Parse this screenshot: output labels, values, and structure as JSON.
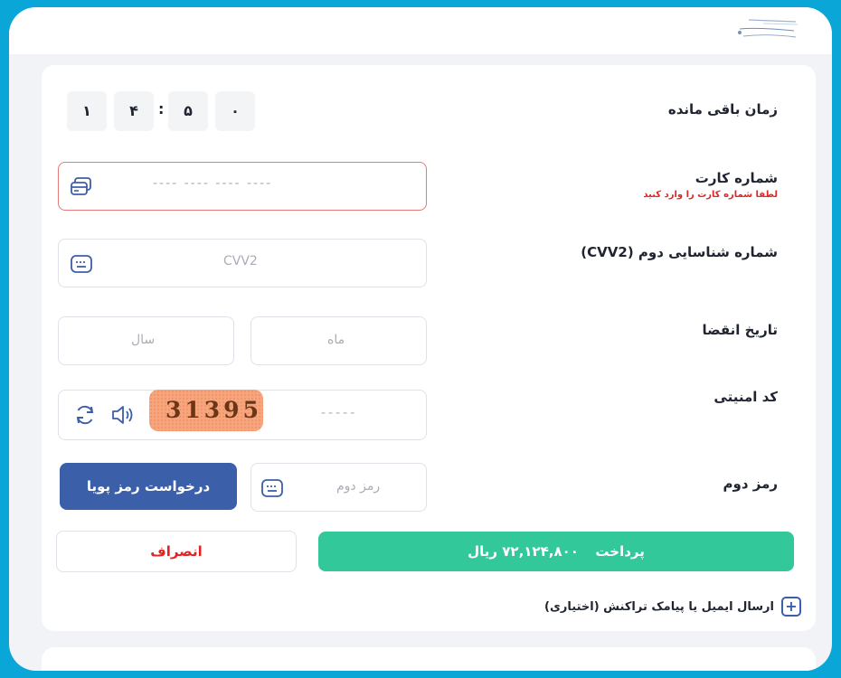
{
  "timer": {
    "label": "زمان باقی مانده",
    "digits": [
      "۰",
      "۵",
      "۴",
      "۱"
    ],
    "separator": ":"
  },
  "card_number": {
    "label": "شماره کارت",
    "error": "لطفا شماره کارت را وارد کنید",
    "placeholder": "---- ---- ---- ----"
  },
  "cvv2": {
    "label": "شماره شناسایی دوم (CVV2)",
    "placeholder": "CVV2"
  },
  "expiry": {
    "label": "تاریخ انقضا",
    "month_placeholder": "ماه",
    "year_placeholder": "سال"
  },
  "captcha": {
    "label": "کد امنیتی",
    "placeholder": "-----",
    "image_text": "31395"
  },
  "second_password": {
    "label": "رمز دوم",
    "placeholder": "رمز دوم",
    "request_button": "درخواست رمز پویا"
  },
  "actions": {
    "pay_label": "پرداخت",
    "pay_amount": "۷۲,۱۲۴,۸۰۰ ریال",
    "cancel_label": "انصراف"
  },
  "optional": {
    "label": "ارسال ایمیل یا پیامک تراکنش (اختیاری)",
    "icon": "+"
  },
  "colors": {
    "accent_blue": "#3c5fa9",
    "pay_green": "#33c89a",
    "error_red": "#e02424",
    "frame_cyan": "#0aa6d8"
  }
}
